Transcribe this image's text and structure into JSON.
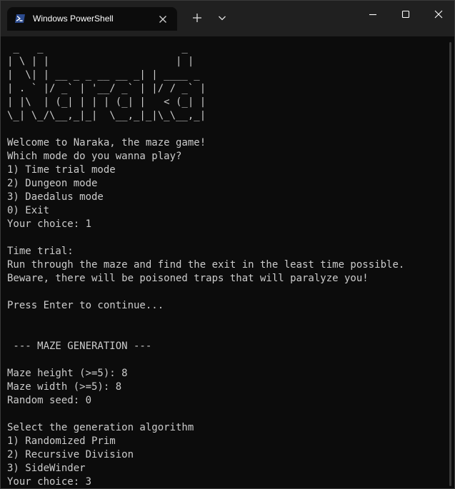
{
  "window": {
    "tab_title": "Windows PowerShell",
    "tab_icon": "powershell-icon",
    "accent_color": "#2c4b8f"
  },
  "console": {
    "lines": [
      " _   _                       _",
      "| \\ | |                     | |",
      "|  \\| | __ _ _ __ __ _| | ____ _",
      "| . ` |/ _` | '__/ _` | |/ / _` |",
      "| |\\  | (_| | | | (_| |   < (_| |",
      "\\_| \\_/\\__,_|_|  \\__,_|_|\\_\\__,_|",
      "",
      "Welcome to Naraka, the maze game!",
      "Which mode do you wanna play?",
      "1) Time trial mode",
      "2) Dungeon mode",
      "3) Daedalus mode",
      "0) Exit",
      "Your choice: 1",
      "",
      "Time trial:",
      "Run through the maze and find the exit in the least time possible.",
      "Beware, there will be poisoned traps that will paralyze you!",
      "",
      "Press Enter to continue...",
      "",
      "",
      " --- MAZE GENERATION ---",
      "",
      "Maze height (>=5): 8",
      "Maze width (>=5): 8",
      "Random seed: 0",
      "",
      "Select the generation algorithm",
      "1) Randomized Prim",
      "2) Recursive Division",
      "3) SideWinder",
      "Your choice: 3"
    ]
  }
}
